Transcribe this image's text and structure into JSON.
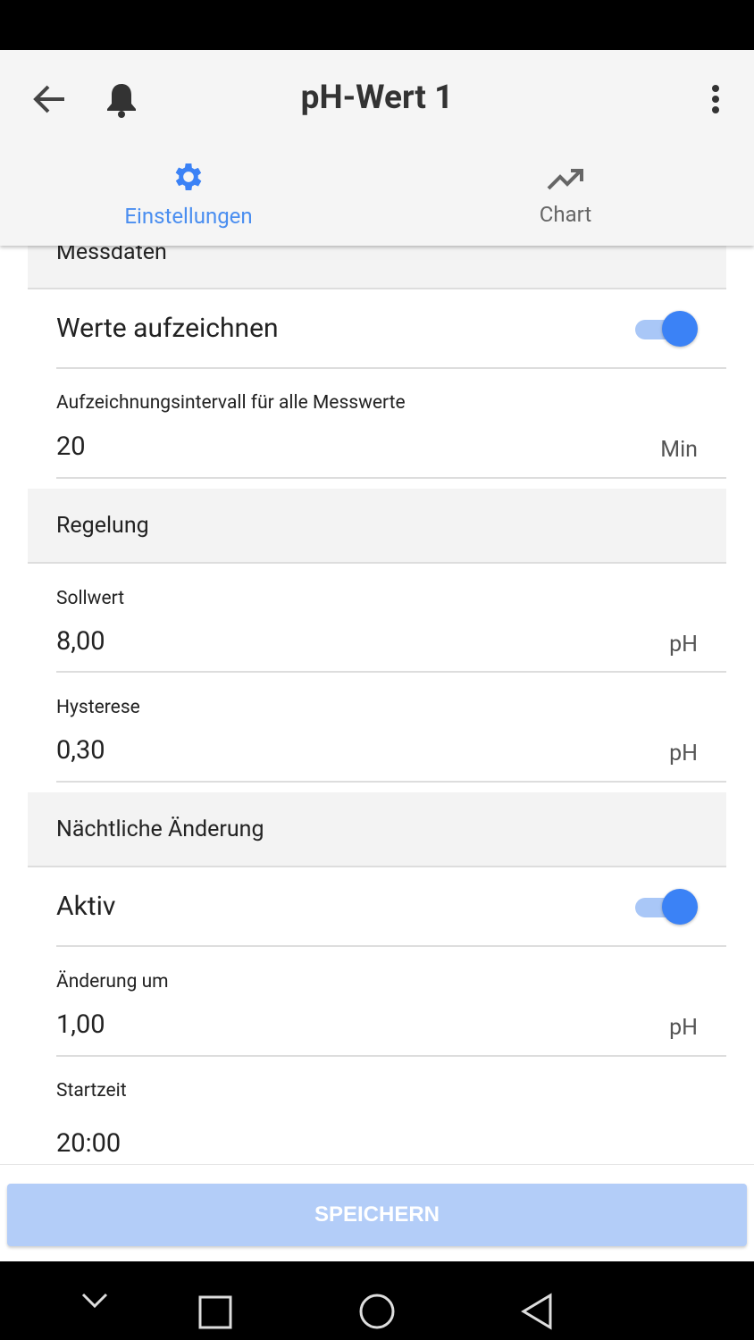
{
  "header": {
    "title": "pH-Wert 1"
  },
  "tabs": [
    {
      "label": "Einstellungen",
      "icon": "gear-icon",
      "active": true
    },
    {
      "label": "Chart",
      "icon": "trending-up-icon",
      "active": false
    }
  ],
  "accent": "#3b82f6",
  "sections": {
    "messdaten": "Messdaten",
    "regelung": "Regelung",
    "nacht": "Nächtliche Änderung"
  },
  "fields": {
    "record": {
      "label": "Werte aufzeichnen",
      "on": true
    },
    "interval": {
      "label": "Aufzeichnungsintervall für alle Messwerte",
      "value": "20",
      "unit": "Min"
    },
    "setpoint": {
      "label": "Sollwert",
      "value": "8,00",
      "unit": "pH"
    },
    "hysteresis": {
      "label": "Hysterese",
      "value": "0,30",
      "unit": "pH"
    },
    "active": {
      "label": "Aktiv",
      "on": true
    },
    "change": {
      "label": "Änderung um",
      "value": "1,00",
      "unit": "pH"
    },
    "start": {
      "label": "Startzeit",
      "value": "20:00"
    }
  },
  "save_label": "SPEICHERN"
}
